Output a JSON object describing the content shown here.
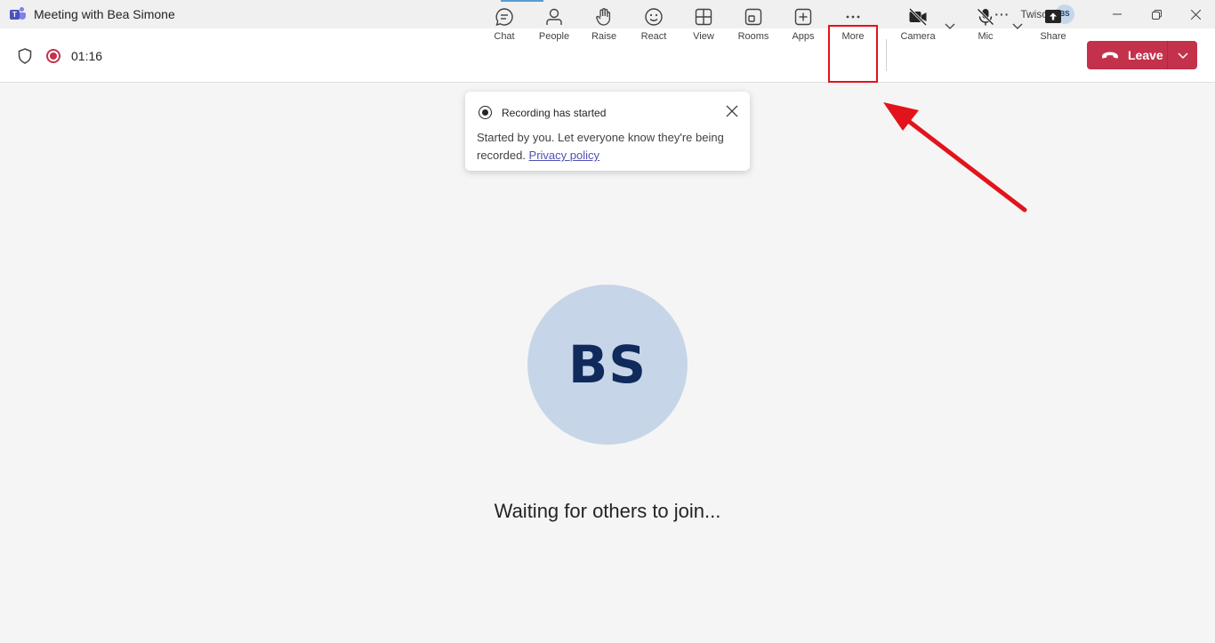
{
  "window": {
    "title": "Meeting with Bea Simone",
    "more_options": "···",
    "user_name": "Twiso",
    "user_initials": "BS"
  },
  "toolbar": {
    "timer": "01:16",
    "tools": [
      {
        "label": "Chat",
        "icon": "chat-icon"
      },
      {
        "label": "People",
        "icon": "people-icon"
      },
      {
        "label": "Raise",
        "icon": "hand-icon"
      },
      {
        "label": "React",
        "icon": "smile-icon"
      },
      {
        "label": "View",
        "icon": "grid-icon"
      },
      {
        "label": "Rooms",
        "icon": "rooms-icon"
      },
      {
        "label": "Apps",
        "icon": "plus-box-icon"
      },
      {
        "label": "More",
        "icon": "ellipsis-icon"
      },
      {
        "label": "Camera",
        "icon": "camera-off-icon"
      },
      {
        "label": "Mic",
        "icon": "mic-off-icon"
      },
      {
        "label": "Share",
        "icon": "share-icon"
      }
    ],
    "leave_label": "Leave"
  },
  "notice": {
    "title": "Recording has started",
    "body": "Started by you. Let everyone know they're being recorded.",
    "link": "Privacy policy"
  },
  "stage": {
    "participant_initials": "BS",
    "waiting_text": "Waiting for others to join..."
  },
  "colors": {
    "accent": "#c4314b",
    "highlight": "#e3131b",
    "avatar_bg": "#c7d5e8"
  }
}
